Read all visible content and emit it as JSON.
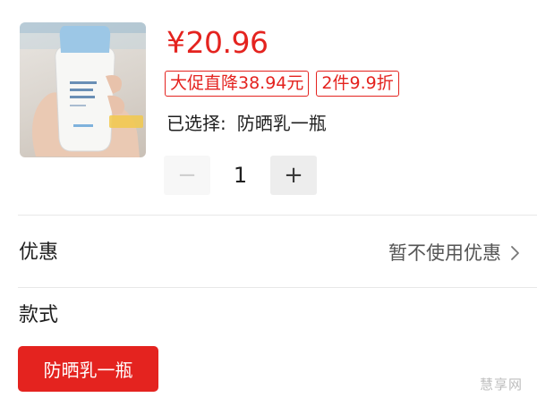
{
  "product": {
    "image_icon": "sunscreen-bottle-image",
    "price_symbol": "¥",
    "price_value": "20.96",
    "promo_tags": [
      "大促直降38.94元",
      "2件9.9折"
    ],
    "selected_label": "已选择:",
    "selected_value": "防晒乳一瓶"
  },
  "quantity": {
    "minus_label": "−",
    "value": "1",
    "plus_label": "+"
  },
  "coupon": {
    "label": "优惠",
    "value": "暂不使用优惠",
    "chevron_icon": "chevron-right-icon"
  },
  "style": {
    "title": "款式",
    "options": [
      {
        "label": "防晒乳一瓶",
        "selected": true
      }
    ]
  },
  "watermark": "慧享网",
  "colors": {
    "accent": "#e4231f",
    "divider": "#e8e8e8"
  }
}
